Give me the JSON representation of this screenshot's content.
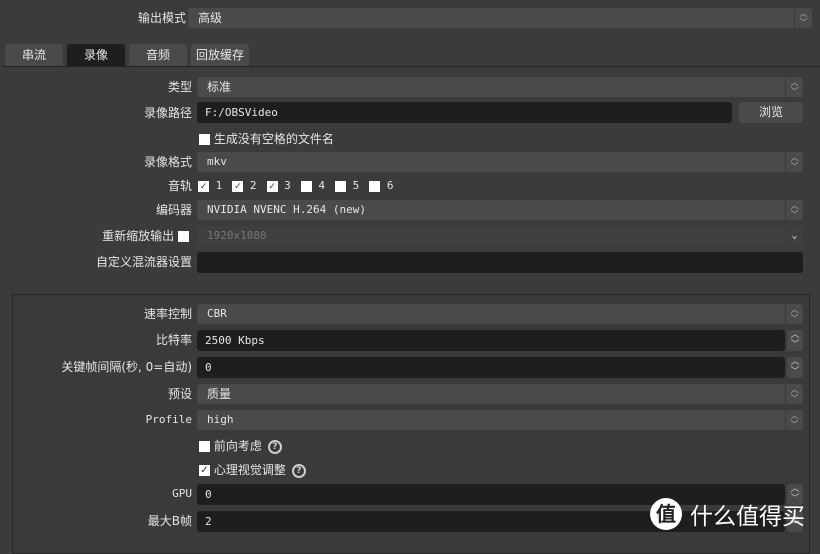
{
  "output_mode": {
    "label": "输出模式",
    "value": "高级"
  },
  "tabs": [
    {
      "label": "串流"
    },
    {
      "label": "录像",
      "active": true
    },
    {
      "label": "音频"
    },
    {
      "label": "回放缓存"
    }
  ],
  "recording": {
    "type": {
      "label": "类型",
      "value": "标准"
    },
    "path": {
      "label": "录像路径",
      "value": "F:/OBSVideo",
      "browse": "浏览"
    },
    "no_space": {
      "label": "生成没有空格的文件名",
      "checked": false
    },
    "format": {
      "label": "录像格式",
      "value": "mkv"
    },
    "tracks": {
      "label": "音轨",
      "items": [
        {
          "n": "1",
          "checked": true
        },
        {
          "n": "2",
          "checked": true
        },
        {
          "n": "3",
          "checked": true
        },
        {
          "n": "4",
          "checked": false
        },
        {
          "n": "5",
          "checked": false
        },
        {
          "n": "6",
          "checked": false
        }
      ]
    },
    "encoder": {
      "label": "编码器",
      "value": "NVIDIA NVENC H.264 (new)"
    },
    "rescale": {
      "label": "重新缩放输出",
      "checked": false,
      "value": "1920x1080"
    },
    "muxer": {
      "label": "自定义混流器设置",
      "value": ""
    }
  },
  "encoder_settings": {
    "rate_control": {
      "label": "速率控制",
      "value": "CBR"
    },
    "bitrate": {
      "label": "比特率",
      "value": "2500 Kbps"
    },
    "keyframe": {
      "label": "关键帧间隔(秒, 0=自动)",
      "value": "0"
    },
    "preset": {
      "label": "预设",
      "value": "质量"
    },
    "profile": {
      "label": "Profile",
      "value": "high"
    },
    "lookahead": {
      "label": "前向考虑",
      "checked": false
    },
    "psycho": {
      "label": "心理视觉调整",
      "checked": true
    },
    "gpu": {
      "label": "GPU",
      "value": "0"
    },
    "bframes": {
      "label": "最大B帧",
      "value": "2"
    }
  },
  "watermark": {
    "logo": "值",
    "text": "什么值得买"
  }
}
